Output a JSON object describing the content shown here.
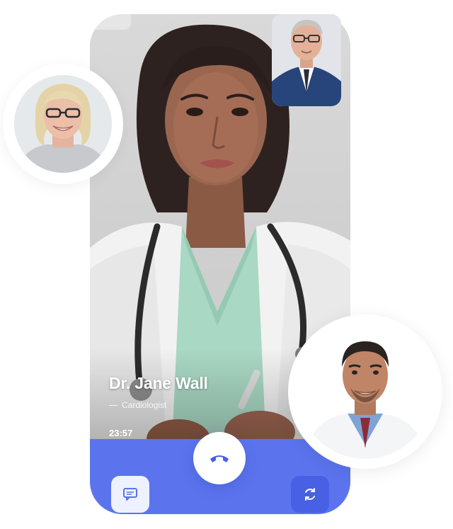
{
  "call": {
    "caller_name": "Dr. Jane Wall",
    "caller_role": "Cardiologist",
    "timer": "23:57"
  },
  "icons": {
    "end_call": "phone-hangup-icon",
    "chat": "chat-bubble-icon",
    "switch_camera": "camera-switch-icon"
  },
  "colors": {
    "call_bar": "#5b74ee",
    "end_call_icon": "#4860e3",
    "switch_camera_button": "#4860e3",
    "chat_button": "#eef1ff"
  }
}
